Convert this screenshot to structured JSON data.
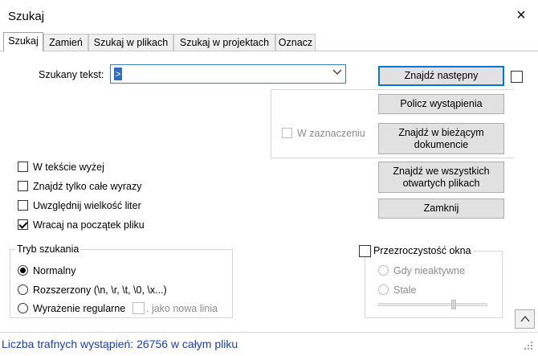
{
  "window": {
    "title": "Szukaj",
    "close_icon": "×"
  },
  "tabs": [
    {
      "label": "Szukaj",
      "active": true
    },
    {
      "label": "Zamień",
      "active": false
    },
    {
      "label": "Szukaj w plikach",
      "active": false
    },
    {
      "label": "Szukaj w projektach",
      "active": false
    },
    {
      "label": "Oznacz",
      "active": false
    }
  ],
  "search": {
    "label": "Szukany tekst:",
    "value": "",
    "caret_glyph": ">"
  },
  "buttons": {
    "find_next": "Znajdź następny",
    "count": "Policz wystąpienia",
    "find_in_current": "Znajdź w bieżącym dokumencie",
    "find_in_all": "Znajdź we wszystkich otwartych plikach",
    "close": "Zamknij"
  },
  "in_selection": {
    "label": "W zaznaczeniu",
    "checked": false,
    "enabled": false
  },
  "options": [
    {
      "label": "W tekście wyżej",
      "checked": false
    },
    {
      "label": "Znajdź tylko całe wyrazy",
      "checked": false
    },
    {
      "label": "Uwzględnij wielkość liter",
      "checked": false
    },
    {
      "label": "Wracaj na początek pliku",
      "checked": true
    }
  ],
  "search_mode": {
    "title": "Tryb szukania",
    "options": [
      {
        "label": "Normalny",
        "selected": true
      },
      {
        "label": "Rozszerzony (\\n, \\r, \\t, \\0, \\x...)",
        "selected": false
      },
      {
        "label": "Wyrażenie regularne",
        "selected": false
      }
    ],
    "newline_label": ". jako nowa linia"
  },
  "transparency": {
    "title": "Przezroczystość okna",
    "options": [
      {
        "label": "Gdy nieaktywne"
      },
      {
        "label": "Stale"
      }
    ],
    "slider_level": 0.7
  },
  "collapse_button": "^",
  "status": {
    "text": "Liczba trafnych wystąpień: 26756 w całym pliku"
  }
}
